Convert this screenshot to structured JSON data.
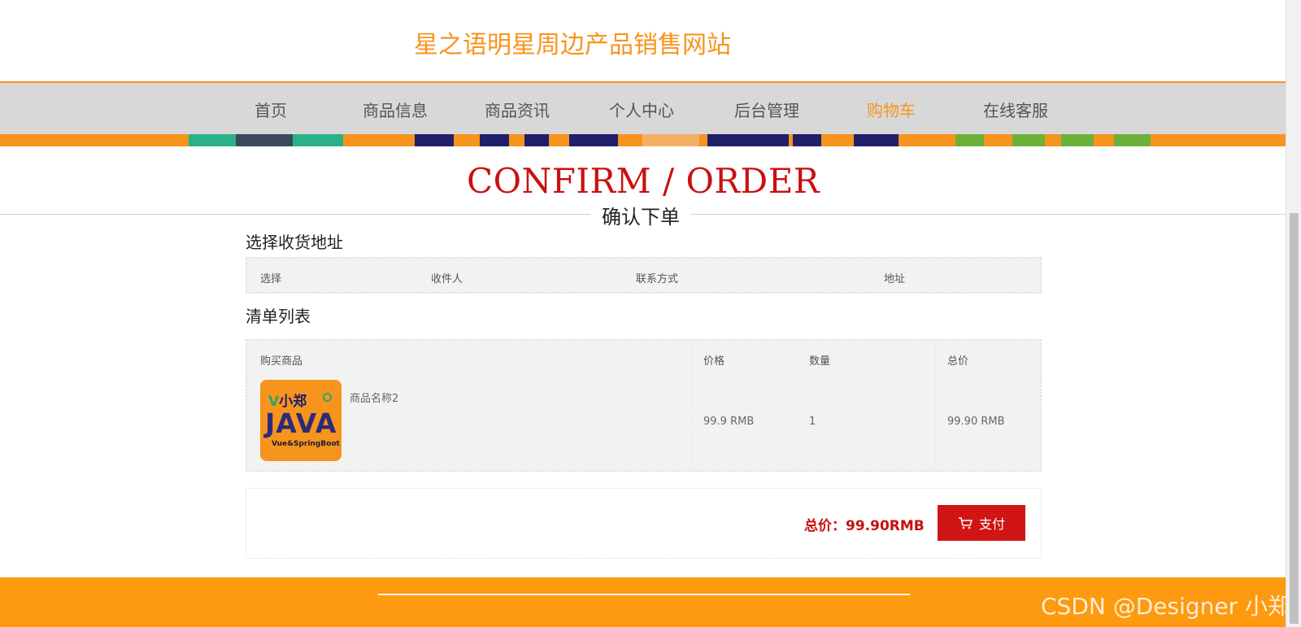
{
  "header": {
    "site_title": "星之语明星周边产品销售网站"
  },
  "nav": {
    "items": [
      {
        "label": "首页"
      },
      {
        "label": "商品信息"
      },
      {
        "label": "商品资讯"
      },
      {
        "label": "个人中心"
      },
      {
        "label": "后台管理"
      },
      {
        "label": "购物车"
      },
      {
        "label": "在线客服"
      }
    ],
    "active_item": "购物车"
  },
  "page": {
    "title_en": "CONFIRM / ORDER",
    "title_cn": "确认下单"
  },
  "address_section": {
    "heading": "选择收货地址",
    "columns": [
      "选择",
      "收件人",
      "联系方式",
      "地址"
    ]
  },
  "order_section": {
    "heading": "清单列表",
    "columns": [
      "购买商品",
      "价格",
      "数量",
      "总价"
    ],
    "items": [
      {
        "thumbnail_brand": "小郑",
        "thumbnail_title": "JAVA",
        "thumbnail_subtitle": "Vue&SpringBoot",
        "name": "商品名称2",
        "price": "99.9 RMB",
        "quantity": "1",
        "total": "99.90 RMB"
      }
    ]
  },
  "summary": {
    "total_label": "总价：99.90RMB",
    "pay_label": "支付",
    "pay_icon": "cart-icon"
  },
  "watermark": "CSDN @Designer 小郑",
  "colors": {
    "accent": "#f7941d",
    "title_red": "#c81111",
    "pay_button": "#d11414",
    "footer": "#fd9a0f",
    "nav_bg": "#d8d8d8"
  }
}
